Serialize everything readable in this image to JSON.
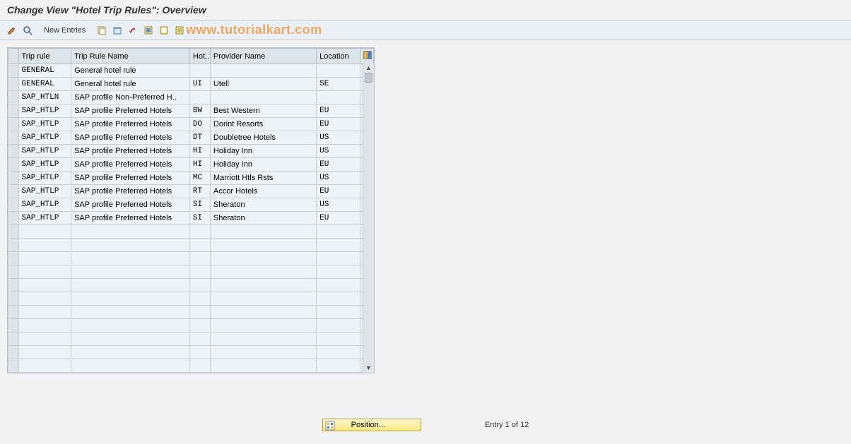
{
  "title": "Change View \"Hotel Trip Rules\": Overview",
  "toolbar": {
    "new_entries": "New Entries"
  },
  "watermark": "www.tutorialkart.com",
  "columns": {
    "trip_rule": "Trip rule",
    "trip_rule_name": "Trip Rule Name",
    "hot": "Hot...",
    "provider_name": "Provider Name",
    "location": "Location"
  },
  "rows": [
    {
      "rule": "GENERAL",
      "name": "General hotel rule",
      "hot": "",
      "prov": "",
      "loc": ""
    },
    {
      "rule": "GENERAL",
      "name": "General hotel rule",
      "hot": "UI",
      "prov": "Utell",
      "loc": "SE"
    },
    {
      "rule": "SAP_HTLN",
      "name": "SAP profile Non-Preferred H..",
      "hot": "",
      "prov": "",
      "loc": ""
    },
    {
      "rule": "SAP_HTLP",
      "name": "SAP profile Preferred Hotels",
      "hot": "BW",
      "prov": "Best Western",
      "loc": "EU"
    },
    {
      "rule": "SAP_HTLP",
      "name": "SAP profile Preferred Hotels",
      "hot": "DO",
      "prov": "Dorint Resorts",
      "loc": "EU"
    },
    {
      "rule": "SAP_HTLP",
      "name": "SAP profile Preferred Hotels",
      "hot": "DT",
      "prov": "Doubletree Hotels",
      "loc": "US"
    },
    {
      "rule": "SAP_HTLP",
      "name": "SAP profile Preferred Hotels",
      "hot": "HI",
      "prov": "Holiday Inn",
      "loc": "US"
    },
    {
      "rule": "SAP_HTLP",
      "name": "SAP profile Preferred Hotels",
      "hot": "HI",
      "prov": "Holiday Inn",
      "loc": "EU"
    },
    {
      "rule": "SAP_HTLP",
      "name": "SAP profile Preferred Hotels",
      "hot": "MC",
      "prov": "Marriott Htls Rsts",
      "loc": "US"
    },
    {
      "rule": "SAP_HTLP",
      "name": "SAP profile Preferred Hotels",
      "hot": "RT",
      "prov": "Accor Hotels",
      "loc": "EU"
    },
    {
      "rule": "SAP_HTLP",
      "name": "SAP profile Preferred Hotels",
      "hot": "SI",
      "prov": "Sheraton",
      "loc": "US"
    },
    {
      "rule": "SAP_HTLP",
      "name": "SAP profile Preferred Hotels",
      "hot": "SI",
      "prov": "Sheraton",
      "loc": "EU"
    }
  ],
  "empty_row_count": 11,
  "footer": {
    "position_btn": "Position...",
    "entry_text": "Entry 1 of 12"
  }
}
